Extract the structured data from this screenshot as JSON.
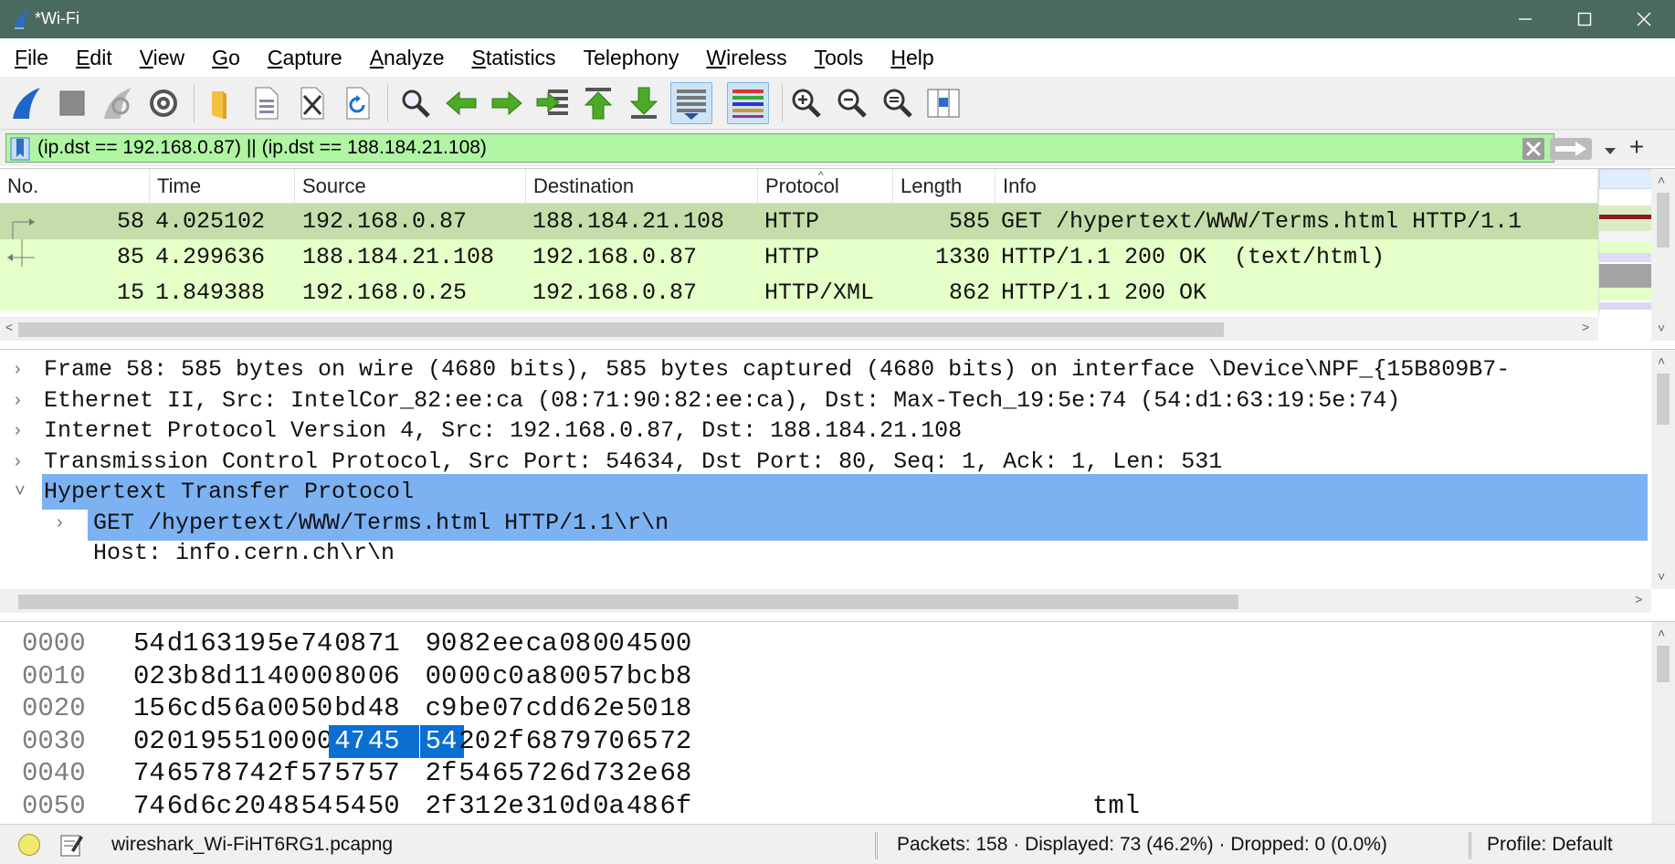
{
  "window": {
    "title": "*Wi-Fi",
    "minimize_icon": "minimize-icon",
    "maximize_icon": "maximize-icon",
    "close_icon": "close-icon"
  },
  "menu": [
    {
      "label": "File",
      "mnemonic": "F",
      "rest": "ile"
    },
    {
      "label": "Edit",
      "mnemonic": "E",
      "rest": "dit"
    },
    {
      "label": "View",
      "mnemonic": "V",
      "rest": "iew"
    },
    {
      "label": "Go",
      "mnemonic": "G",
      "rest": "o"
    },
    {
      "label": "Capture",
      "mnemonic": "C",
      "rest": "apture"
    },
    {
      "label": "Analyze",
      "mnemonic": "A",
      "rest": "nalyze"
    },
    {
      "label": "Statistics",
      "mnemonic": "S",
      "rest": "tatistics"
    },
    {
      "label": "Telephony",
      "mnemonic": "",
      "rest": "Telephony"
    },
    {
      "label": "Wireless",
      "mnemonic": "W",
      "rest": "ireless"
    },
    {
      "label": "Tools",
      "mnemonic": "T",
      "rest": "ools"
    },
    {
      "label": "Help",
      "mnemonic": "H",
      "rest": "elp"
    }
  ],
  "toolbar": {
    "icons": [
      "start-capture-icon",
      "stop-capture-icon",
      "restart-capture-icon",
      "capture-options-icon",
      "open-file-icon",
      "save-file-icon",
      "close-file-icon",
      "reload-file-icon",
      "find-packet-icon",
      "go-back-icon",
      "go-forward-icon",
      "go-to-packet-icon",
      "go-first-icon",
      "go-last-icon",
      "auto-scroll-icon",
      "colorize-icon",
      "zoom-in-icon",
      "zoom-out-icon",
      "zoom-reset-icon",
      "resize-columns-icon"
    ]
  },
  "filter": {
    "value": "(ip.dst == 192.168.0.87) || (ip.dst == 188.184.21.108)",
    "bookmark_icon": "bookmark-icon",
    "clear_icon": "clear-filter-icon",
    "apply_icon": "apply-filter-arrow-icon",
    "dropdown_icon": "chevron-down-icon",
    "add_label": "+"
  },
  "packet_list": {
    "columns": [
      "No.",
      "Time",
      "Source",
      "Destination",
      "Protocol",
      "Length",
      "Info"
    ],
    "sort_indicator": "^",
    "rows": [
      {
        "no": "58",
        "time": "4.025102",
        "source": "192.168.0.87",
        "destination": "188.184.21.108",
        "protocol": "HTTP",
        "length": "585",
        "info": "GET /hypertext/WWW/Terms.html HTTP/1.1",
        "selected": true
      },
      {
        "no": "85",
        "time": "4.299636",
        "source": "188.184.21.108",
        "destination": "192.168.0.87",
        "protocol": "HTTP",
        "length": "1330",
        "info": "HTTP/1.1 200 OK  (text/html)",
        "selected": false
      },
      {
        "no": "15",
        "time": "1.849388",
        "source": "192.168.0.25",
        "destination": "192.168.0.87",
        "protocol": "HTTP/XML",
        "length": "862",
        "info": "HTTP/1.1 200 OK",
        "selected": false
      }
    ],
    "colors": {
      "row_bg": "#e4ffc7",
      "selected_bg": "#c4ddaa",
      "related_bg": "#e4ffc7"
    }
  },
  "detail": {
    "rows": [
      {
        "text": "Frame 58: 585 bytes on wire (4680 bits), 585 bytes captured (4680 bits) on interface \\Device\\NPF_{15B809B7-",
        "expanded": false,
        "level": 0,
        "selected": false
      },
      {
        "text": "Ethernet II, Src: IntelCor_82:ee:ca (08:71:90:82:ee:ca), Dst: Max-Tech_19:5e:74 (54:d1:63:19:5e:74)",
        "expanded": false,
        "level": 0,
        "selected": false
      },
      {
        "text": "Internet Protocol Version 4, Src: 192.168.0.87, Dst: 188.184.21.108",
        "expanded": false,
        "level": 0,
        "selected": false
      },
      {
        "text": "Transmission Control Protocol, Src Port: 54634, Dst Port: 80, Seq: 1, Ack: 1, Len: 531",
        "expanded": false,
        "level": 0,
        "selected": false
      },
      {
        "text": "Hypertext Transfer Protocol",
        "expanded": true,
        "level": 0,
        "selected": true
      },
      {
        "text": "GET /hypertext/WWW/Terms.html HTTP/1.1\\r\\n",
        "expanded": false,
        "level": 1,
        "selected": true
      },
      {
        "text": "Host: info.cern.ch\\r\\n",
        "expanded": null,
        "level": 1,
        "selected": false
      }
    ],
    "selected_color": "#7cb2f2"
  },
  "bytes": {
    "rows": [
      {
        "offset": "0000",
        "bytes": [
          "54",
          "d1",
          "63",
          "19",
          "5e",
          "74",
          "08",
          "71",
          "90",
          "82",
          "ee",
          "ca",
          "08",
          "00",
          "45",
          "00"
        ],
        "ascii": ""
      },
      {
        "offset": "0010",
        "bytes": [
          "02",
          "3b",
          "8d",
          "11",
          "40",
          "00",
          "80",
          "06",
          "00",
          "00",
          "c0",
          "a8",
          "00",
          "57",
          "bc",
          "b8"
        ],
        "ascii": ""
      },
      {
        "offset": "0020",
        "bytes": [
          "15",
          "6c",
          "d5",
          "6a",
          "00",
          "50",
          "bd",
          "48",
          "c9",
          "be",
          "07",
          "cd",
          "d6",
          "2e",
          "50",
          "18"
        ],
        "ascii": ""
      },
      {
        "offset": "0030",
        "bytes": [
          "02",
          "01",
          "95",
          "51",
          "00",
          "00",
          "47",
          "45",
          "54",
          "20",
          "2f",
          "68",
          "79",
          "70",
          "65",
          "72"
        ],
        "ascii": "",
        "selected_bytes": [
          6,
          7,
          8
        ]
      },
      {
        "offset": "0040",
        "bytes": [
          "74",
          "65",
          "78",
          "74",
          "2f",
          "57",
          "57",
          "57",
          "2f",
          "54",
          "65",
          "72",
          "6d",
          "73",
          "2e",
          "68"
        ],
        "ascii": ""
      },
      {
        "offset": "0050",
        "bytes": [
          "74",
          "6d",
          "6c",
          "20",
          "48",
          "54",
          "54",
          "50",
          "2f",
          "31",
          "2e",
          "31",
          "0d",
          "0a",
          "48",
          "6f"
        ],
        "ascii": "tml"
      }
    ],
    "selection_color": "#0a6fd1"
  },
  "status": {
    "led_icon": "capture-status-led-icon",
    "comment_icon": "edit-comment-icon",
    "file": "wireshark_Wi-FiHT6RG1.pcapng",
    "counts": "Packets: 158 · Displayed: 73 (46.2%) · Dropped: 0 (0.0%)",
    "profile": "Profile: Default"
  }
}
